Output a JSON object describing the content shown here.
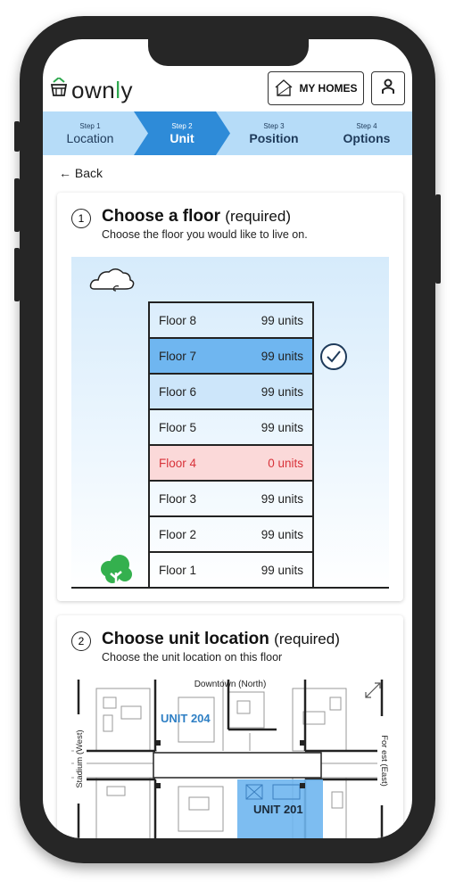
{
  "app": {
    "brand_prefix": "own",
    "brand_accent": "l",
    "brand_suffix": "y",
    "my_homes_label": "MY HOMES"
  },
  "steps": [
    {
      "small": "Step 1",
      "label": "Location"
    },
    {
      "small": "Step 2",
      "label": "Unit"
    },
    {
      "small": "Step 3",
      "label": "Position"
    },
    {
      "small": "Step 4",
      "label": "Options"
    }
  ],
  "back_label": "← Back",
  "floor_section": {
    "number": "1",
    "title": "Choose a floor",
    "required": "(required)",
    "subtitle": "Choose the floor you would like to live on.",
    "floors": [
      {
        "name": "Floor 8",
        "units": "99 units"
      },
      {
        "name": "Floor 7",
        "units": "99 units"
      },
      {
        "name": "Floor 6",
        "units": "99 units"
      },
      {
        "name": "Floor 5",
        "units": "99 units"
      },
      {
        "name": "Floor 4",
        "units": "0 units"
      },
      {
        "name": "Floor 3",
        "units": "99 units"
      },
      {
        "name": "Floor 2",
        "units": "99 units"
      },
      {
        "name": "Floor 1",
        "units": "99 units"
      }
    ]
  },
  "unit_section": {
    "number": "2",
    "title": "Choose unit location",
    "required": "(required)",
    "subtitle": "Choose the unit location on this floor",
    "north": "Downtown (North)",
    "west": "Stadium (West)",
    "east": "For est (East)",
    "unit_a": "UNIT 204",
    "unit_b": "UNIT 201"
  },
  "colors": {
    "accent_blue": "#2e8bd8",
    "selected_floor": "#6fb6f0",
    "unavailable_floor": "#fbd9d9",
    "brand_green": "#2fa84f"
  }
}
